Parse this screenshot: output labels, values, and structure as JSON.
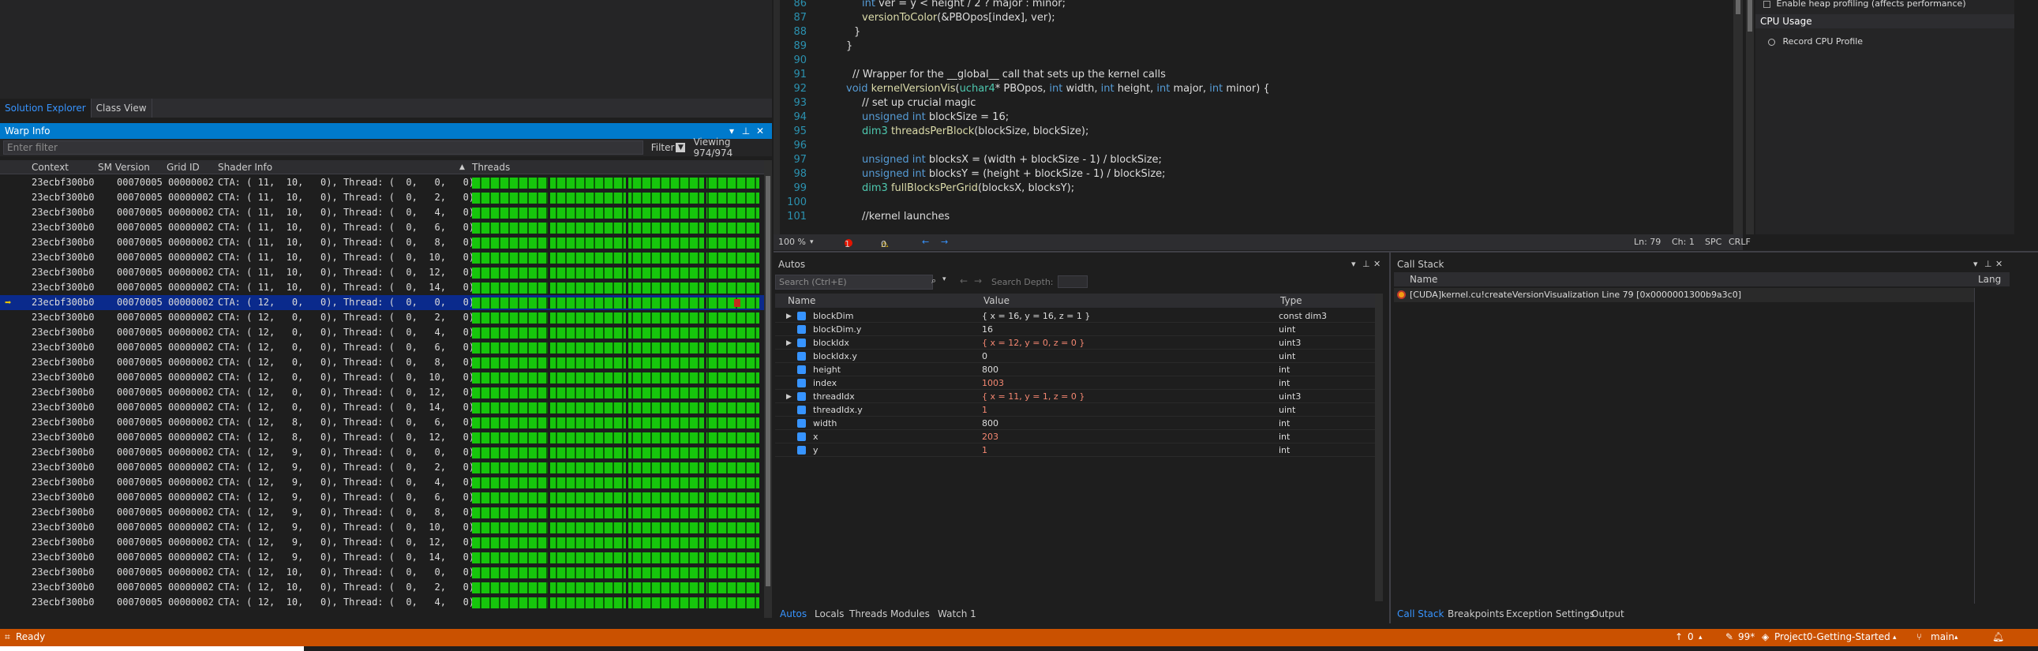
{
  "solution_tabs": [
    "Solution Explorer",
    "Class View"
  ],
  "warp_info": {
    "title": "Warp Info",
    "filter_placeholder": "Enter filter",
    "filter_label": "Filter",
    "viewing": "Viewing 974/974",
    "columns": [
      "Context",
      "SM Version",
      "Grid ID",
      "Shader Info",
      "Threads"
    ],
    "rows": [
      {
        "context": "23ecbf300b0",
        "sm": "00070005",
        "grid": "00000002",
        "info": "CTA: ( 11,  10,   0), Thread: (  0,   0,   0)"
      },
      {
        "context": "23ecbf300b0",
        "sm": "00070005",
        "grid": "00000002",
        "info": "CTA: ( 11,  10,   0), Thread: (  0,   2,   0)"
      },
      {
        "context": "23ecbf300b0",
        "sm": "00070005",
        "grid": "00000002",
        "info": "CTA: ( 11,  10,   0), Thread: (  0,   4,   0)"
      },
      {
        "context": "23ecbf300b0",
        "sm": "00070005",
        "grid": "00000002",
        "info": "CTA: ( 11,  10,   0), Thread: (  0,   6,   0)"
      },
      {
        "context": "23ecbf300b0",
        "sm": "00070005",
        "grid": "00000002",
        "info": "CTA: ( 11,  10,   0), Thread: (  0,   8,   0)"
      },
      {
        "context": "23ecbf300b0",
        "sm": "00070005",
        "grid": "00000002",
        "info": "CTA: ( 11,  10,   0), Thread: (  0,  10,   0)"
      },
      {
        "context": "23ecbf300b0",
        "sm": "00070005",
        "grid": "00000002",
        "info": "CTA: ( 11,  10,   0), Thread: (  0,  12,   0)"
      },
      {
        "context": "23ecbf300b0",
        "sm": "00070005",
        "grid": "00000002",
        "info": "CTA: ( 11,  10,   0), Thread: (  0,  14,   0)"
      },
      {
        "context": "23ecbf300b0",
        "sm": "00070005",
        "grid": "00000002",
        "info": "CTA: ( 12,   0,   0), Thread: (  0,   0,   0)",
        "current": true
      },
      {
        "context": "23ecbf300b0",
        "sm": "00070005",
        "grid": "00000002",
        "info": "CTA: ( 12,   0,   0), Thread: (  0,   2,   0)"
      },
      {
        "context": "23ecbf300b0",
        "sm": "00070005",
        "grid": "00000002",
        "info": "CTA: ( 12,   0,   0), Thread: (  0,   4,   0)"
      },
      {
        "context": "23ecbf300b0",
        "sm": "00070005",
        "grid": "00000002",
        "info": "CTA: ( 12,   0,   0), Thread: (  0,   6,   0)"
      },
      {
        "context": "23ecbf300b0",
        "sm": "00070005",
        "grid": "00000002",
        "info": "CTA: ( 12,   0,   0), Thread: (  0,   8,   0)"
      },
      {
        "context": "23ecbf300b0",
        "sm": "00070005",
        "grid": "00000002",
        "info": "CTA: ( 12,   0,   0), Thread: (  0,  10,   0)"
      },
      {
        "context": "23ecbf300b0",
        "sm": "00070005",
        "grid": "00000002",
        "info": "CTA: ( 12,   0,   0), Thread: (  0,  12,   0)"
      },
      {
        "context": "23ecbf300b0",
        "sm": "00070005",
        "grid": "00000002",
        "info": "CTA: ( 12,   0,   0), Thread: (  0,  14,   0)"
      },
      {
        "context": "23ecbf300b0",
        "sm": "00070005",
        "grid": "00000002",
        "info": "CTA: ( 12,   8,   0), Thread: (  0,   6,   0)"
      },
      {
        "context": "23ecbf300b0",
        "sm": "00070005",
        "grid": "00000002",
        "info": "CTA: ( 12,   8,   0), Thread: (  0,  12,   0)"
      },
      {
        "context": "23ecbf300b0",
        "sm": "00070005",
        "grid": "00000002",
        "info": "CTA: ( 12,   9,   0), Thread: (  0,   0,   0)"
      },
      {
        "context": "23ecbf300b0",
        "sm": "00070005",
        "grid": "00000002",
        "info": "CTA: ( 12,   9,   0), Thread: (  0,   2,   0)"
      },
      {
        "context": "23ecbf300b0",
        "sm": "00070005",
        "grid": "00000002",
        "info": "CTA: ( 12,   9,   0), Thread: (  0,   4,   0)"
      },
      {
        "context": "23ecbf300b0",
        "sm": "00070005",
        "grid": "00000002",
        "info": "CTA: ( 12,   9,   0), Thread: (  0,   6,   0)"
      },
      {
        "context": "23ecbf300b0",
        "sm": "00070005",
        "grid": "00000002",
        "info": "CTA: ( 12,   9,   0), Thread: (  0,   8,   0)"
      },
      {
        "context": "23ecbf300b0",
        "sm": "00070005",
        "grid": "00000002",
        "info": "CTA: ( 12,   9,   0), Thread: (  0,  10,   0)"
      },
      {
        "context": "23ecbf300b0",
        "sm": "00070005",
        "grid": "00000002",
        "info": "CTA: ( 12,   9,   0), Thread: (  0,  12,   0)"
      },
      {
        "context": "23ecbf300b0",
        "sm": "00070005",
        "grid": "00000002",
        "info": "CTA: ( 12,   9,   0), Thread: (  0,  14,   0)"
      },
      {
        "context": "23ecbf300b0",
        "sm": "00070005",
        "grid": "00000002",
        "info": "CTA: ( 12,  10,   0), Thread: (  0,   0,   0)"
      },
      {
        "context": "23ecbf300b0",
        "sm": "00070005",
        "grid": "00000002",
        "info": "CTA: ( 12,  10,   0), Thread: (  0,   2,   0)"
      },
      {
        "context": "23ecbf300b0",
        "sm": "00070005",
        "grid": "00000002",
        "info": "CTA: ( 12,  10,   0), Thread: (  0,   4,   0)"
      }
    ]
  },
  "editor": {
    "lines": [
      {
        "n": "86",
        "text": "int ver = y < height / 2 ? major : minor;"
      },
      {
        "n": "87",
        "text": "versionToColor(&PBOpos[index], ver);"
      },
      {
        "n": "88",
        "text": "}"
      },
      {
        "n": "89",
        "text": "}"
      },
      {
        "n": "90",
        "text": ""
      },
      {
        "n": "91",
        "text": "// Wrapper for the __global__ call that sets up the kernel calls"
      },
      {
        "n": "92",
        "text": "void kernelVersionVis(uchar4* PBOpos, int width, int height, int major, int minor) {"
      },
      {
        "n": "93",
        "text": "// set up crucial magic"
      },
      {
        "n": "94",
        "text": "unsigned int blockSize = 16;"
      },
      {
        "n": "95",
        "text": "dim3 threadsPerBlock(blockSize, blockSize);"
      },
      {
        "n": "96",
        "text": ""
      },
      {
        "n": "97",
        "text": "unsigned int blocksX = (width + blockSize - 1) / blockSize;"
      },
      {
        "n": "98",
        "text": "unsigned int blocksY = (height + blockSize - 1) / blockSize;"
      },
      {
        "n": "99",
        "text": "dim3 fullBlocksPerGrid(blocksX, blocksY);"
      },
      {
        "n": "100",
        "text": ""
      },
      {
        "n": "101",
        "text": "//kernel launches"
      }
    ],
    "status": {
      "zoom": "100 %",
      "errors": "1",
      "warnings": "0",
      "ln": "Ln: 79",
      "ch": "Ch: 1",
      "spc": "SPC",
      "eol": "CRLF"
    }
  },
  "diagnostics": {
    "heap_item": "Enable heap profiling (affects performance)",
    "cpu_title": "CPU Usage",
    "record_label": "Record CPU Profile"
  },
  "autos": {
    "title": "Autos",
    "search_placeholder": "Search (Ctrl+E)",
    "search_depth": "Search Depth:",
    "columns": [
      "Name",
      "Value",
      "Type"
    ],
    "rows": [
      {
        "expand": true,
        "name": "blockDim",
        "value": "{ x = 16, y = 16, z = 1 }",
        "type": "const dim3",
        "changed": false
      },
      {
        "expand": false,
        "name": "blockDim.y",
        "value": "16",
        "type": "uint",
        "changed": false
      },
      {
        "expand": true,
        "name": "blockIdx",
        "value": "{ x = 12, y = 0, z = 0 }",
        "type": "uint3",
        "changed": true
      },
      {
        "expand": false,
        "name": "blockIdx.y",
        "value": "0",
        "type": "uint",
        "changed": false
      },
      {
        "expand": false,
        "name": "height",
        "value": "800",
        "type": "int",
        "changed": false
      },
      {
        "expand": false,
        "name": "index",
        "value": "1003",
        "type": "int",
        "changed": true
      },
      {
        "expand": true,
        "name": "threadIdx",
        "value": "{ x = 11, y = 1, z = 0 }",
        "type": "uint3",
        "changed": true
      },
      {
        "expand": false,
        "name": "threadIdx.y",
        "value": "1",
        "type": "uint",
        "changed": true
      },
      {
        "expand": false,
        "name": "width",
        "value": "800",
        "type": "int",
        "changed": false
      },
      {
        "expand": false,
        "name": "x",
        "value": "203",
        "type": "int",
        "changed": true
      },
      {
        "expand": false,
        "name": "y",
        "value": "1",
        "type": "int",
        "changed": true
      }
    ],
    "tabs": [
      "Autos",
      "Locals",
      "Threads",
      "Modules",
      "Watch 1"
    ]
  },
  "call_stack": {
    "title": "Call Stack",
    "columns": [
      "Name",
      "Lang"
    ],
    "frame": "[CUDA]kernel.cu!createVersionVisualization Line 79 [0x0000001300b9a3c0]",
    "tabs": [
      "Call Stack",
      "Breakpoints",
      "Exception Settings",
      "Output"
    ]
  },
  "status_bar": {
    "ready": "Ready",
    "up": "0",
    "edits": "99*",
    "project": "Project0-Getting-Started",
    "branch": "main"
  },
  "colors": {
    "accent": "#007acc",
    "status_bar": "#ca5100",
    "thread_active": "#16c60c",
    "changed_value": "#f48771"
  }
}
